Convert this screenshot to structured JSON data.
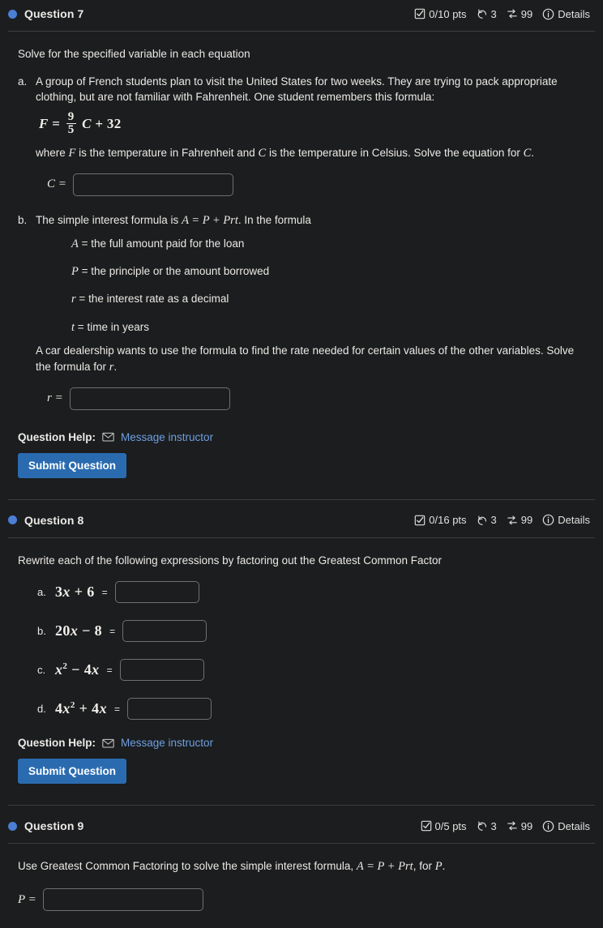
{
  "questions": [
    {
      "id": "q7",
      "title": "Question 7",
      "points": "0/10 pts",
      "attempts": "3",
      "versions": "99",
      "details": "Details",
      "prompt": "Solve for the specified variable in each equation",
      "part_a": {
        "marker": "a.",
        "text_1": "A group of French students plan to visit the United States for two weeks. They are trying to pack appropriate clothing, but are not familiar with Fahrenheit. One student remembers this formula:",
        "formula": {
          "lhs": "F",
          "eq": "=",
          "num": "9",
          "den": "5",
          "var": "C",
          "plus": "+",
          "const": "32"
        },
        "where_1": "where ",
        "where_var1": "F",
        "where_2": " is the temperature in Fahrenheit and ",
        "where_var2": "C",
        "where_3": " is the temperature in Celsius. Solve the equation for ",
        "where_var3": "C",
        "where_4": ".",
        "answer_label": "C =",
        "answer_value": ""
      },
      "part_b": {
        "marker": "b.",
        "text_1": "The simple interest formula is ",
        "formula_inline": "A = P + Prt",
        "text_2": ". In the formula",
        "defs": [
          {
            "var": "A",
            "eq": "=",
            "desc": "the full amount paid for the loan"
          },
          {
            "var": "P",
            "eq": "=",
            "desc": "the principle or the amount borrowed"
          },
          {
            "var": "r",
            "eq": "=",
            "desc": "the interest rate as a decimal"
          },
          {
            "var": "t",
            "eq": " =",
            "desc": "time in years"
          }
        ],
        "closing_1": "A car dealership wants to use the formula to find the rate needed for certain values of the other variables.  Solve the formula for ",
        "closing_var": "r",
        "closing_2": ".",
        "answer_label": "r =",
        "answer_value": ""
      },
      "help_label": "Question Help:",
      "help_link": "Message instructor",
      "submit_label": "Submit Question"
    },
    {
      "id": "q8",
      "title": "Question 8",
      "points": "0/16 pts",
      "attempts": "3",
      "versions": "99",
      "details": "Details",
      "prompt": "Rewrite each of the following expressions by factoring out the Greatest Common Factor",
      "items": [
        {
          "letter": "a.",
          "expr_html": "3<span class=\"mi\">x</span> + 6",
          "eq": "=",
          "value": ""
        },
        {
          "letter": "b.",
          "expr_html": "20<span class=\"mi\">x</span> − 8",
          "eq": "=",
          "value": ""
        },
        {
          "letter": "c.",
          "expr_html": "<span class=\"mi\">x</span><sup>2</sup> − 4<span class=\"mi\">x</span>",
          "eq": "=",
          "value": ""
        },
        {
          "letter": "d.",
          "expr_html": "4<span class=\"mi\">x</span><sup>2</sup> + 4<span class=\"mi\">x</span>",
          "eq": "=",
          "value": ""
        }
      ],
      "help_label": "Question Help:",
      "help_link": "Message instructor",
      "submit_label": "Submit Question"
    },
    {
      "id": "q9",
      "title": "Question 9",
      "points": "0/5 pts",
      "attempts": "3",
      "versions": "99",
      "details": "Details",
      "prompt_1": "Use Greatest Common Factoring to solve the simple interest formula, ",
      "prompt_formula": "A = P + Prt",
      "prompt_2": ", for ",
      "prompt_var": "P",
      "prompt_3": ".",
      "answer_label": "P =",
      "answer_value": ""
    }
  ],
  "icons": {
    "status_dot": "circle-icon",
    "points": "checkbox-checked-icon",
    "attempts": "undo-arrow-icon",
    "versions": "shuffle-icon",
    "details": "info-circle-icon",
    "message": "envelope-icon"
  },
  "colors": {
    "background": "#1b1d1f",
    "text": "#ece9e4",
    "accent_blue": "#4a7fd4",
    "link_blue": "#6f9fe0",
    "button_blue": "#2a6bb0",
    "border": "#6d7073",
    "divider": "#3c3f42"
  }
}
